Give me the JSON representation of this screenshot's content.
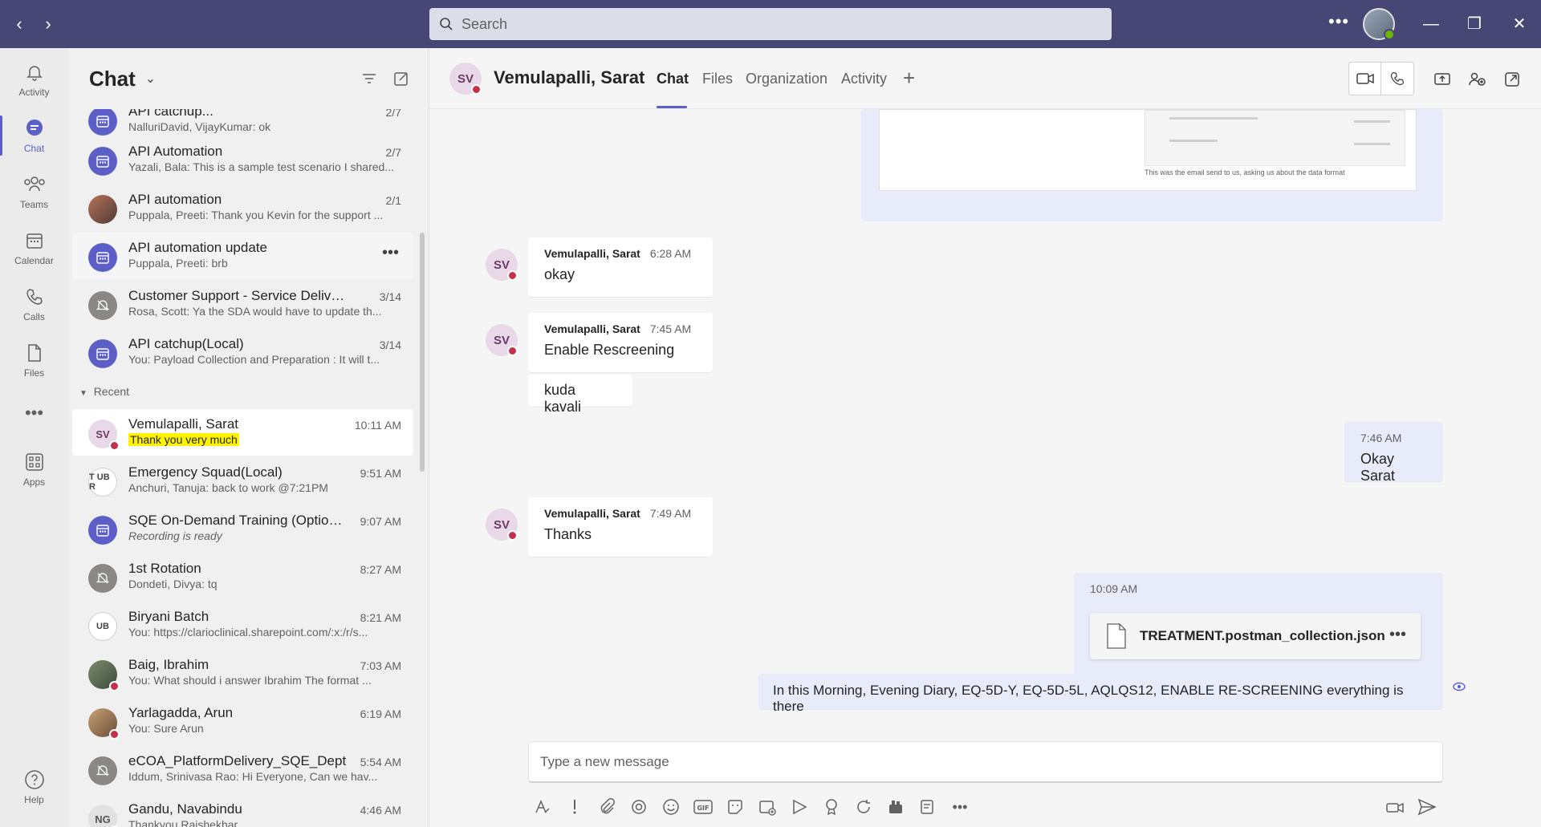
{
  "search": {
    "placeholder": "Search"
  },
  "rail": [
    {
      "label": "Activity",
      "icon": "bell-icon"
    },
    {
      "label": "Chat",
      "icon": "chat-icon"
    },
    {
      "label": "Teams",
      "icon": "teams-icon"
    },
    {
      "label": "Calendar",
      "icon": "calendar-icon"
    },
    {
      "label": "Calls",
      "icon": "phone-icon"
    },
    {
      "label": "Files",
      "icon": "file-icon"
    },
    {
      "label": "Apps",
      "icon": "apps-icon"
    },
    {
      "label": "Help",
      "icon": "help-icon"
    }
  ],
  "chatlist": {
    "title": "Chat",
    "section_recent": "Recent",
    "pinned": [
      {
        "name": "API catchup...",
        "preview": "NalluriDavid, VijayKumar: ok",
        "time": "2/7"
      },
      {
        "name": "API Automation",
        "preview": "Yazali, Bala: This is a sample test scenario I shared...",
        "time": "2/7"
      },
      {
        "name": "API automation",
        "preview": "Puppala, Preeti: Thank you Kevin for the support ...",
        "time": "2/1"
      },
      {
        "name": "API automation update",
        "preview": "Puppala, Preeti: brb",
        "time": ""
      },
      {
        "name": "Customer Support - Service Delivery Te...",
        "preview": "Rosa, Scott: Ya the SDA would have to update th...",
        "time": "3/14"
      },
      {
        "name": "API catchup(Local)",
        "preview": "You: Payload Collection and Preparation : It will t...",
        "time": "3/14"
      }
    ],
    "recent": [
      {
        "name": "Vemulapalli, Sarat",
        "preview": "Thank you very much",
        "time": "10:11 AM",
        "initials": "SV"
      },
      {
        "name": "Emergency Squad(Local)",
        "preview": "Anchuri, Tanuja: back to work @7:21PM",
        "time": "9:51 AM",
        "initials": "T UB R"
      },
      {
        "name": "SQE On-Demand Training (Option 2...",
        "preview": "Recording is ready",
        "time": "9:07 AM"
      },
      {
        "name": "1st Rotation",
        "preview": "Dondeti, Divya: tq",
        "time": "8:27 AM"
      },
      {
        "name": "Biryani Batch",
        "preview": "You: https://clarioclinical.sharepoint.com/:x:/r/s...",
        "time": "8:21 AM",
        "initials": "UB"
      },
      {
        "name": "Baig, Ibrahim",
        "preview": "You: What should i answer Ibrahim The format ...",
        "time": "7:03 AM"
      },
      {
        "name": "Yarlagadda, Arun",
        "preview": "You: Sure Arun",
        "time": "6:19 AM"
      },
      {
        "name": "eCOA_PlatformDelivery_SQE_Dept",
        "preview": "Iddum, Srinivasa Rao: Hi Everyone, Can we hav...",
        "time": "5:54 AM"
      },
      {
        "name": "Gandu, Navabindu",
        "preview": "Thankyou Rajshekhar",
        "time": "4:46 AM",
        "initials": "NG"
      }
    ]
  },
  "conversation": {
    "initials": "SV",
    "name": "Vemulapalli, Sarat",
    "tabs": [
      "Chat",
      "Files",
      "Organization",
      "Activity"
    ],
    "shared_caption": "This was the email send to us, asking us about the data format",
    "messages": [
      {
        "sender": "Vemulapalli, Sarat",
        "time": "6:28 AM",
        "text": "okay"
      },
      {
        "sender": "Vemulapalli, Sarat",
        "time": "7:45 AM",
        "text": "Enable Rescreening",
        "followup": "kuda kavali"
      },
      {
        "time": "7:46 AM",
        "text": "Okay Sarat"
      },
      {
        "sender": "Vemulapalli, Sarat",
        "time": "7:49 AM",
        "text": "Thanks"
      },
      {
        "time": "10:09 AM",
        "file": "TREATMENT.postman_collection.json"
      },
      {
        "text": "In this Morning, Evening Diary, EQ-5D-Y, EQ-5D-5L, AQLQS12, ENABLE RE-SCREENING everything is there"
      }
    ]
  },
  "composer": {
    "placeholder": "Type a new message"
  },
  "colors": {
    "titlebar": "#464775",
    "accent": "#5b5fc7",
    "busy": "#c4314b",
    "available": "#6bb700",
    "highlight": "#fff200"
  }
}
